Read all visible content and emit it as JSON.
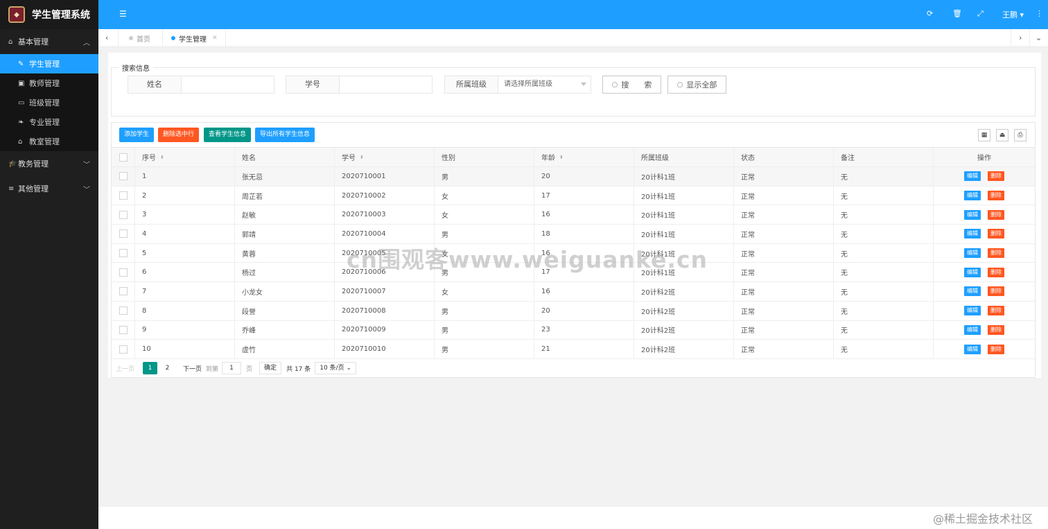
{
  "app": {
    "title": "学生管理系统"
  },
  "sidebar": {
    "groups": [
      {
        "label": "基本管理",
        "icon": "home-icon",
        "expanded": true,
        "items": [
          {
            "label": "学生管理",
            "icon": "pencil-icon",
            "active": true
          },
          {
            "label": "教师管理",
            "icon": "briefcase-icon"
          },
          {
            "label": "班级管理",
            "icon": "window-icon"
          },
          {
            "label": "专业管理",
            "icon": "leaf-icon"
          },
          {
            "label": "教室管理",
            "icon": "bank-icon"
          }
        ]
      },
      {
        "label": "教务管理",
        "icon": "graduation-cap-icon",
        "expanded": false
      },
      {
        "label": "其他管理",
        "icon": "list-icon",
        "expanded": false
      }
    ]
  },
  "topbar": {
    "user_name": "王鹏",
    "accent": "#1e9fff"
  },
  "tabs": [
    {
      "label": "首页",
      "active": false
    },
    {
      "label": "学生管理",
      "active": true
    }
  ],
  "search": {
    "legend": "搜索信息",
    "name_label": "姓名",
    "name_value": "",
    "id_label": "学号",
    "id_value": "",
    "class_label": "所属班级",
    "class_placeholder": "请选择所属班级",
    "search_button": "搜　　索",
    "show_all_button": "显示全部"
  },
  "toolbar": {
    "add": "添加学生",
    "delete_selected": "删除选中行",
    "view": "查看学生信息",
    "export": "导出所有学生信息"
  },
  "table": {
    "columns": [
      "序号",
      "姓名",
      "学号",
      "性别",
      "年龄",
      "所属班级",
      "状态",
      "备注",
      "操作"
    ],
    "edit_label": "编辑",
    "delete_label": "删除",
    "rows": [
      {
        "seq": "1",
        "name": "张无忌",
        "id": "2020710001",
        "gender": "男",
        "age": "20",
        "class": "20计科1班",
        "status": "正常",
        "note": "无"
      },
      {
        "seq": "2",
        "name": "周芷若",
        "id": "2020710002",
        "gender": "女",
        "age": "17",
        "class": "20计科1班",
        "status": "正常",
        "note": "无"
      },
      {
        "seq": "3",
        "name": "赵敏",
        "id": "2020710003",
        "gender": "女",
        "age": "16",
        "class": "20计科1班",
        "status": "正常",
        "note": "无"
      },
      {
        "seq": "4",
        "name": "郭靖",
        "id": "2020710004",
        "gender": "男",
        "age": "18",
        "class": "20计科1班",
        "status": "正常",
        "note": "无"
      },
      {
        "seq": "5",
        "name": "黄蓉",
        "id": "2020710005",
        "gender": "女",
        "age": "16",
        "class": "20计科1班",
        "status": "正常",
        "note": "无"
      },
      {
        "seq": "6",
        "name": "杨过",
        "id": "2020710006",
        "gender": "男",
        "age": "17",
        "class": "20计科1班",
        "status": "正常",
        "note": "无"
      },
      {
        "seq": "7",
        "name": "小龙女",
        "id": "2020710007",
        "gender": "女",
        "age": "16",
        "class": "20计科2班",
        "status": "正常",
        "note": "无"
      },
      {
        "seq": "8",
        "name": "段誉",
        "id": "2020710008",
        "gender": "男",
        "age": "20",
        "class": "20计科2班",
        "status": "正常",
        "note": "无"
      },
      {
        "seq": "9",
        "name": "乔峰",
        "id": "2020710009",
        "gender": "男",
        "age": "23",
        "class": "20计科2班",
        "status": "正常",
        "note": "无"
      },
      {
        "seq": "10",
        "name": "虚竹",
        "id": "2020710010",
        "gender": "男",
        "age": "21",
        "class": "20计科2班",
        "status": "正常",
        "note": "无"
      }
    ]
  },
  "pager": {
    "prev": "上一页",
    "current": "1",
    "page2": "2",
    "next": "下一页",
    "goto_label": "到第",
    "goto_value": "1",
    "page_unit": "页",
    "confirm": "确定",
    "total": "共 17 条",
    "page_size": "10 条/页"
  },
  "watermarks": {
    "center": "cn围观客www.weiguanke.cn",
    "corner": "@稀土掘金技术社区"
  }
}
